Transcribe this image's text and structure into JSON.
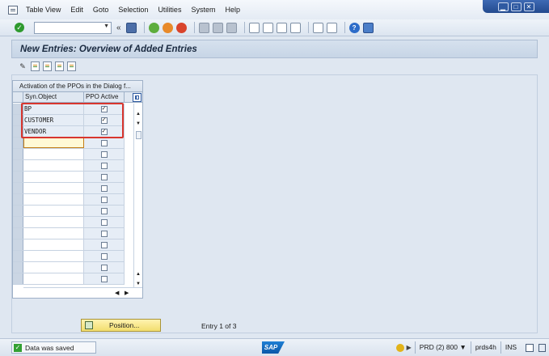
{
  "menubar": {
    "items": [
      {
        "label": "Table View"
      },
      {
        "label": "Edit"
      },
      {
        "label": "Goto"
      },
      {
        "label": "Selection"
      },
      {
        "label": "Utilities"
      },
      {
        "label": "System"
      },
      {
        "label": "Help"
      }
    ]
  },
  "window_controls": {
    "minimize": "▁",
    "maximize": "□",
    "close": "✕"
  },
  "toolbar": {
    "command_value": "",
    "back_glyph": "«"
  },
  "title": "New Entries: Overview of Added Entries",
  "table": {
    "title": "Activation of the PPOs in the Dialog f...",
    "columns": [
      "Syn.Object",
      "PPO Active"
    ],
    "rows": [
      {
        "object": "BP",
        "active": true
      },
      {
        "object": "CUSTOMER",
        "active": true
      },
      {
        "object": "VENDOR",
        "active": true
      },
      {
        "object": "",
        "active": false
      },
      {
        "object": "",
        "active": false
      },
      {
        "object": "",
        "active": false
      },
      {
        "object": "",
        "active": false
      },
      {
        "object": "",
        "active": false
      },
      {
        "object": "",
        "active": false
      },
      {
        "object": "",
        "active": false
      },
      {
        "object": "",
        "active": false
      },
      {
        "object": "",
        "active": false
      },
      {
        "object": "",
        "active": false
      },
      {
        "object": "",
        "active": false
      },
      {
        "object": "",
        "active": false
      },
      {
        "object": "",
        "active": false
      }
    ]
  },
  "position_button": {
    "label": "Position..."
  },
  "entry_info": "Entry 1 of 3",
  "status": {
    "message": "Data was saved",
    "system": "PRD (2) 800",
    "server": "prds4h",
    "mode": "INS",
    "logo": "SAP"
  },
  "colors": {
    "highlight_box": "#d8362e",
    "position_button": "#f2de6e",
    "status_ok": "#33a033"
  }
}
